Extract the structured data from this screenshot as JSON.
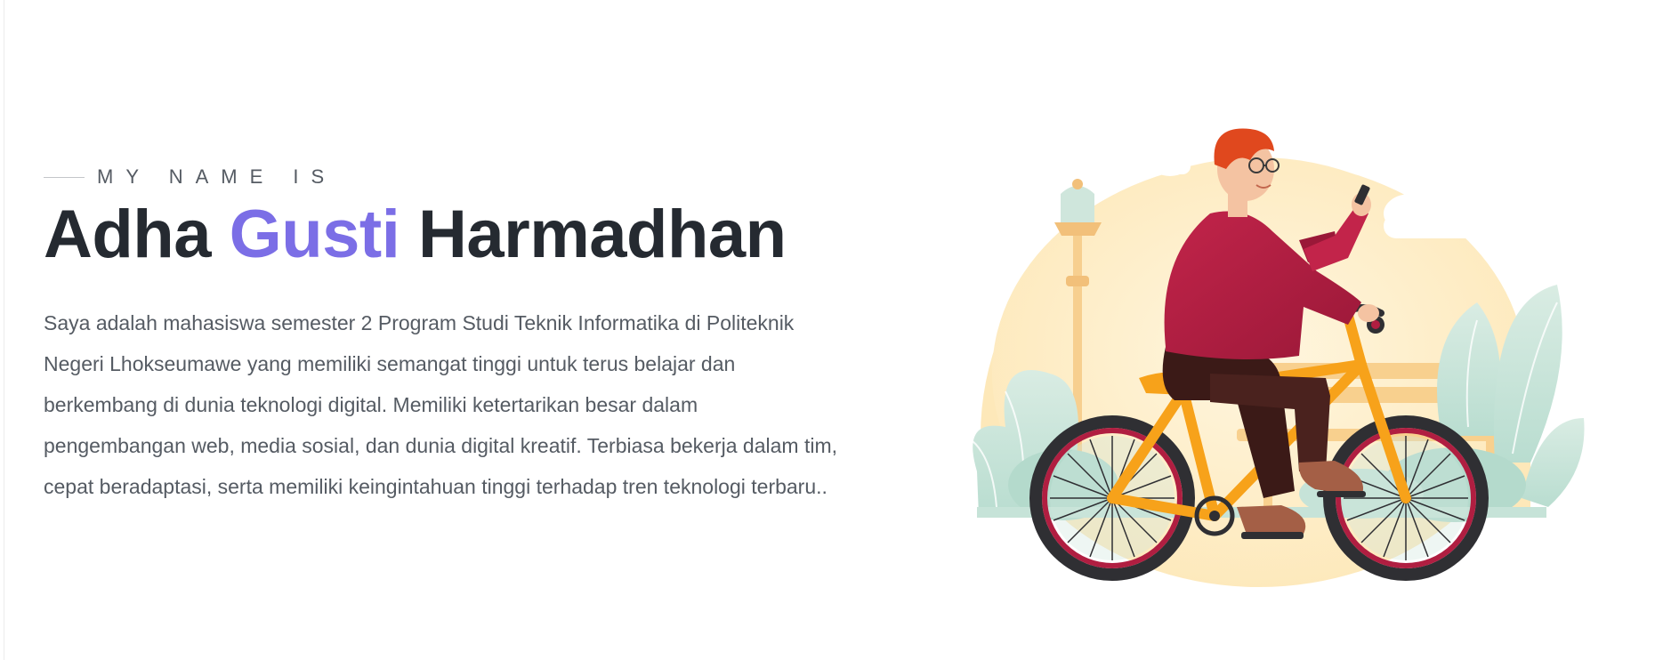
{
  "hero": {
    "eyebrow": "MY NAME IS",
    "name_first": "Adha",
    "name_middle": "Gusti",
    "name_last": "Harmadhan",
    "description": "Saya adalah mahasiswa semester 2 Program Studi Teknik Informatika di Politeknik Negeri Lhokseumawe yang memiliki semangat tinggi untuk terus belajar dan berkembang di dunia teknologi digital. Memiliki ketertarikan besar dalam pengembangan web, media sosial, dan dunia digital kreatif. Terbiasa bekerja dalam tim, cepat beradaptasi, serta memiliki keingintahuan tinggi terhadap tren teknologi terbaru.."
  },
  "colors": {
    "accent": "#7b6ee6",
    "heading": "#252a31",
    "body_text": "#555b63"
  },
  "illustration": {
    "subject": "person-riding-bicycle-illustration"
  }
}
